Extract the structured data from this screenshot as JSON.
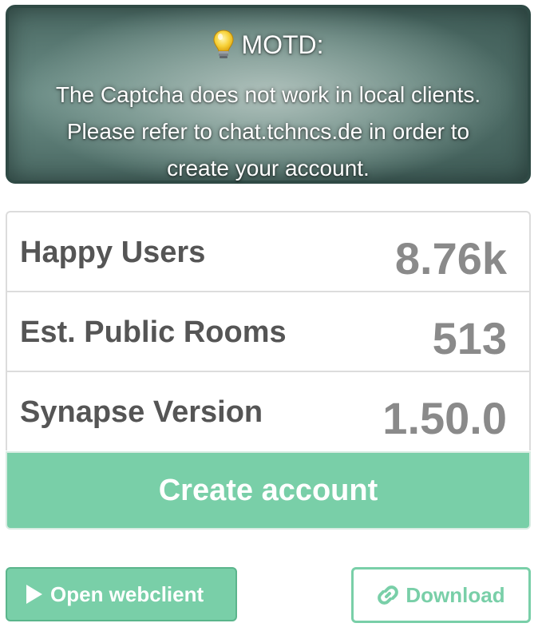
{
  "motd": {
    "icon": "lightbulb-icon",
    "title": "MOTD:",
    "lines": [
      "The Captcha does not work in local clients.",
      "Please refer to chat.tchncs.de in order to",
      "create your account."
    ]
  },
  "stats": [
    {
      "label": "Happy Users",
      "value": "8.76k"
    },
    {
      "label": "Est. Public Rooms",
      "value": "513"
    },
    {
      "label": "Synapse Version",
      "value": "1.50.0"
    }
  ],
  "create_account": {
    "label": "Create account"
  },
  "open_webclient": {
    "label": "Open webclient",
    "icon": "play-icon"
  },
  "download": {
    "label": "Download",
    "icon": "link-icon"
  },
  "colors": {
    "accent": "#79cfa8",
    "motd_border": "#2f4a45",
    "stat_label": "#555555",
    "stat_value": "#8a8a8a"
  }
}
